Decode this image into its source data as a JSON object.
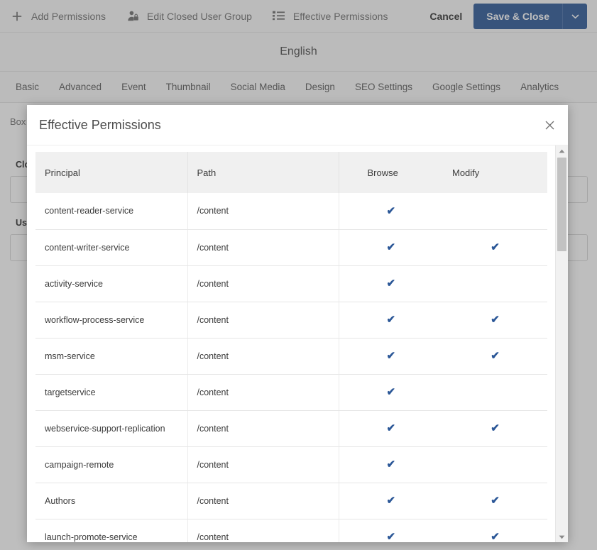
{
  "toolbar": {
    "items": [
      {
        "label": "Add Permissions",
        "icon": "plus-icon"
      },
      {
        "label": "Edit Closed User Group",
        "icon": "user-lock-icon"
      },
      {
        "label": "Effective Permissions",
        "icon": "list-icon"
      }
    ],
    "cancel_label": "Cancel",
    "save_label": "Save & Close",
    "save_caret_icon": "chevron-down-icon",
    "accent_color": "#2b5797"
  },
  "language_header": {
    "title": "English"
  },
  "tabs": [
    {
      "label": "Basic"
    },
    {
      "label": "Advanced"
    },
    {
      "label": "Event"
    },
    {
      "label": "Thumbnail"
    },
    {
      "label": "Social Media"
    },
    {
      "label": "Design"
    },
    {
      "label": "SEO Settings"
    },
    {
      "label": "Google Settings"
    },
    {
      "label": "Analytics"
    }
  ],
  "form": {
    "caption": "Box Caption",
    "closed_user_group_label": "Closed User Group",
    "closed_user_group_value": "",
    "user_label": "User",
    "user_value": ""
  },
  "dialog": {
    "title": "Effective Permissions",
    "close_icon": "close-icon",
    "columns": [
      {
        "label": "Principal"
      },
      {
        "label": "Path"
      },
      {
        "label": "Browse"
      },
      {
        "label": "Modify"
      }
    ],
    "rows": [
      {
        "principal": "content-reader-service",
        "path": "/content",
        "browse": true,
        "modify": false
      },
      {
        "principal": "content-writer-service",
        "path": "/content",
        "browse": true,
        "modify": true
      },
      {
        "principal": "activity-service",
        "path": "/content",
        "browse": true,
        "modify": false
      },
      {
        "principal": "workflow-process-service",
        "path": "/content",
        "browse": true,
        "modify": true
      },
      {
        "principal": "msm-service",
        "path": "/content",
        "browse": true,
        "modify": true
      },
      {
        "principal": "targetservice",
        "path": "/content",
        "browse": true,
        "modify": false
      },
      {
        "principal": "webservice-support-replication",
        "path": "/content",
        "browse": true,
        "modify": true
      },
      {
        "principal": "campaign-remote",
        "path": "/content",
        "browse": true,
        "modify": false
      },
      {
        "principal": "Authors",
        "path": "/content",
        "browse": true,
        "modify": true
      },
      {
        "principal": "launch-promote-service",
        "path": "/content",
        "browse": true,
        "modify": true
      }
    ],
    "check_glyph": "✔",
    "scrollbar": {
      "up_icon": "scroll-up-arrow-icon",
      "down_icon": "scroll-down-arrow-icon",
      "thumb_icon": "scrollbar-thumb"
    }
  }
}
